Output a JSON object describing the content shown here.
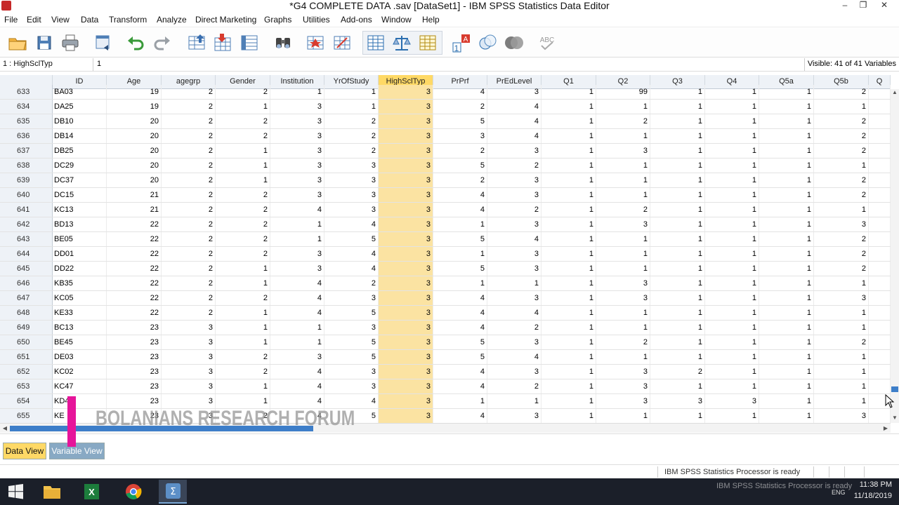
{
  "window": {
    "title": "*G4 COMPLETE DATA .sav [DataSet1] - IBM SPSS Statistics Data Editor",
    "minimize_glyph": "–",
    "maximize_glyph": "❐",
    "close_glyph": "✕",
    "accent_color": "#c62828"
  },
  "menu": [
    "File",
    "Edit",
    "View",
    "Data",
    "Transform",
    "Analyze",
    "Direct Marketing",
    "Graphs",
    "Utilities",
    "Add-ons",
    "Window",
    "Help"
  ],
  "toolbar": {
    "icons": [
      "open-folder-icon",
      "save-icon",
      "print-icon",
      "dialog-recall-icon",
      "undo-icon",
      "redo-icon",
      "goto-case-icon",
      "goto-variable-icon",
      "variables-icon",
      "find-icon",
      "insert-cases-icon",
      "insert-variable-icon",
      "split-file-icon",
      "weight-cases-icon",
      "select-cases-icon",
      "value-labels-icon",
      "use-variable-sets-icon",
      "show-all-variables-icon",
      "spell-check-icon"
    ]
  },
  "cell_editor": {
    "reference": "1 : HighSclTyp",
    "value": "1",
    "visible": "Visible: 41 of 41 Variables"
  },
  "grid": {
    "columns": [
      "ID",
      "Age",
      "agegrp",
      "Gender",
      "Institution",
      "YrOfStudy",
      "HighSclTyp",
      "PrPrf",
      "PrEdLevel",
      "Q1",
      "Q2",
      "Q3",
      "Q4",
      "Q5a",
      "Q5b",
      "Q"
    ],
    "selected_column": "HighSclTyp",
    "rows": [
      {
        "num": "633",
        "cells": [
          "BA03",
          "19",
          "2",
          "2",
          "1",
          "1",
          "3",
          "4",
          "3",
          "1",
          "99",
          "1",
          "1",
          "1",
          "2",
          ""
        ]
      },
      {
        "num": "634",
        "cells": [
          "DA25",
          "19",
          "2",
          "1",
          "3",
          "1",
          "3",
          "2",
          "4",
          "1",
          "1",
          "1",
          "1",
          "1",
          "1",
          ""
        ]
      },
      {
        "num": "635",
        "cells": [
          "DB10",
          "20",
          "2",
          "2",
          "3",
          "2",
          "3",
          "5",
          "4",
          "1",
          "2",
          "1",
          "1",
          "1",
          "2",
          ""
        ]
      },
      {
        "num": "636",
        "cells": [
          "DB14",
          "20",
          "2",
          "2",
          "3",
          "2",
          "3",
          "3",
          "4",
          "1",
          "1",
          "1",
          "1",
          "1",
          "2",
          ""
        ]
      },
      {
        "num": "637",
        "cells": [
          "DB25",
          "20",
          "2",
          "1",
          "3",
          "2",
          "3",
          "2",
          "3",
          "1",
          "3",
          "1",
          "1",
          "1",
          "2",
          ""
        ]
      },
      {
        "num": "638",
        "cells": [
          "DC29",
          "20",
          "2",
          "1",
          "3",
          "3",
          "3",
          "5",
          "2",
          "1",
          "1",
          "1",
          "1",
          "1",
          "1",
          ""
        ]
      },
      {
        "num": "639",
        "cells": [
          "DC37",
          "20",
          "2",
          "1",
          "3",
          "3",
          "3",
          "2",
          "3",
          "1",
          "1",
          "1",
          "1",
          "1",
          "2",
          ""
        ]
      },
      {
        "num": "640",
        "cells": [
          "DC15",
          "21",
          "2",
          "2",
          "3",
          "3",
          "3",
          "4",
          "3",
          "1",
          "1",
          "1",
          "1",
          "1",
          "2",
          ""
        ]
      },
      {
        "num": "641",
        "cells": [
          "KC13",
          "21",
          "2",
          "2",
          "4",
          "3",
          "3",
          "4",
          "2",
          "1",
          "2",
          "1",
          "1",
          "1",
          "1",
          ""
        ]
      },
      {
        "num": "642",
        "cells": [
          "BD13",
          "22",
          "2",
          "2",
          "1",
          "4",
          "3",
          "1",
          "3",
          "1",
          "3",
          "1",
          "1",
          "1",
          "3",
          ""
        ]
      },
      {
        "num": "643",
        "cells": [
          "BE05",
          "22",
          "2",
          "2",
          "1",
          "5",
          "3",
          "5",
          "4",
          "1",
          "1",
          "1",
          "1",
          "1",
          "2",
          ""
        ]
      },
      {
        "num": "644",
        "cells": [
          "DD01",
          "22",
          "2",
          "2",
          "3",
          "4",
          "3",
          "1",
          "3",
          "1",
          "1",
          "1",
          "1",
          "1",
          "2",
          ""
        ]
      },
      {
        "num": "645",
        "cells": [
          "DD22",
          "22",
          "2",
          "1",
          "3",
          "4",
          "3",
          "5",
          "3",
          "1",
          "1",
          "1",
          "1",
          "1",
          "2",
          ""
        ]
      },
      {
        "num": "646",
        "cells": [
          "KB35",
          "22",
          "2",
          "1",
          "4",
          "2",
          "3",
          "1",
          "1",
          "1",
          "3",
          "1",
          "1",
          "1",
          "1",
          ""
        ]
      },
      {
        "num": "647",
        "cells": [
          "KC05",
          "22",
          "2",
          "2",
          "4",
          "3",
          "3",
          "4",
          "3",
          "1",
          "3",
          "1",
          "1",
          "1",
          "3",
          ""
        ]
      },
      {
        "num": "648",
        "cells": [
          "KE33",
          "22",
          "2",
          "1",
          "4",
          "5",
          "3",
          "4",
          "4",
          "1",
          "1",
          "1",
          "1",
          "1",
          "1",
          ""
        ]
      },
      {
        "num": "649",
        "cells": [
          "BC13",
          "23",
          "3",
          "1",
          "1",
          "3",
          "3",
          "4",
          "2",
          "1",
          "1",
          "1",
          "1",
          "1",
          "1",
          ""
        ]
      },
      {
        "num": "650",
        "cells": [
          "BE45",
          "23",
          "3",
          "1",
          "1",
          "5",
          "3",
          "5",
          "3",
          "1",
          "2",
          "1",
          "1",
          "1",
          "2",
          ""
        ]
      },
      {
        "num": "651",
        "cells": [
          "DE03",
          "23",
          "3",
          "2",
          "3",
          "5",
          "3",
          "5",
          "4",
          "1",
          "1",
          "1",
          "1",
          "1",
          "1",
          ""
        ]
      },
      {
        "num": "652",
        "cells": [
          "KC02",
          "23",
          "3",
          "2",
          "4",
          "3",
          "3",
          "4",
          "3",
          "1",
          "3",
          "2",
          "1",
          "1",
          "1",
          ""
        ]
      },
      {
        "num": "653",
        "cells": [
          "KC47",
          "23",
          "3",
          "1",
          "4",
          "3",
          "3",
          "4",
          "2",
          "1",
          "3",
          "1",
          "1",
          "1",
          "1",
          ""
        ]
      },
      {
        "num": "654",
        "cells": [
          "KD4",
          "23",
          "3",
          "1",
          "4",
          "4",
          "3",
          "1",
          "1",
          "1",
          "3",
          "3",
          "3",
          "1",
          "1",
          ""
        ]
      },
      {
        "num": "655",
        "cells": [
          "KE",
          "23",
          "3",
          "2",
          "4",
          "5",
          "3",
          "4",
          "3",
          "1",
          "1",
          "1",
          "1",
          "1",
          "3",
          ""
        ]
      }
    ],
    "selected_color": "#fbe3a2"
  },
  "watermark": "BOLANIANS RESEARCH FORUM",
  "tabs": {
    "data_view": "Data View",
    "variable_view": "Variable View"
  },
  "status": {
    "processor": "IBM SPSS Statistics Processor is ready"
  },
  "taskbar": {
    "apps": [
      "windows-start-icon",
      "file-explorer-icon",
      "excel-icon",
      "chrome-icon",
      "spss-icon"
    ],
    "ghost_status": "IBM SPSS Statistics Processor is ready",
    "language": "ENG",
    "time": "11:38 PM",
    "date": "11/18/2019"
  }
}
